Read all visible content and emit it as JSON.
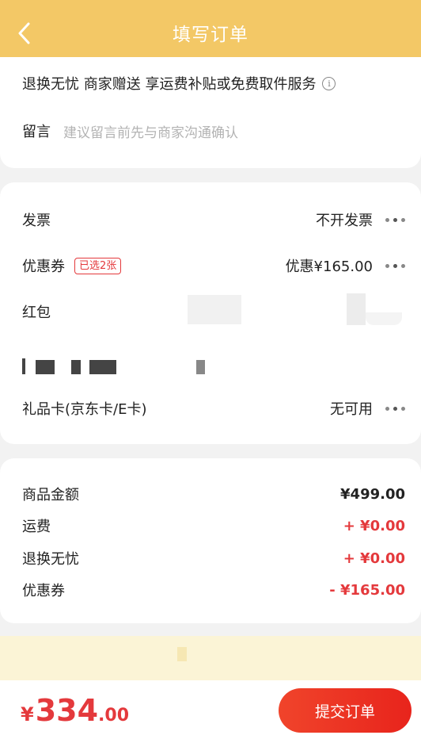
{
  "header": {
    "title": "填写订单"
  },
  "service": {
    "text": "退换无忧 商家赠送 享运费补贴或免费取件服务"
  },
  "note": {
    "label": "留言",
    "placeholder": "建议留言前先与商家沟通确认"
  },
  "options": {
    "invoice": {
      "label": "发票",
      "value": "不开发票"
    },
    "coupon": {
      "label": "优惠券",
      "badge": "已选2张",
      "value": "优惠¥165.00"
    },
    "redpacket": {
      "label": "红包"
    },
    "giftcard": {
      "label": "礼品卡(京东卡/E卡)",
      "value": "无可用"
    }
  },
  "summary": {
    "goods": {
      "label": "商品金额",
      "value": "¥499.00"
    },
    "shipping": {
      "label": "运费",
      "value": "+ ¥0.00"
    },
    "return": {
      "label": "退换无忧",
      "value": "+ ¥0.00"
    },
    "coupon": {
      "label": "优惠券",
      "value": "- ¥165.00"
    }
  },
  "footer": {
    "currency": "¥",
    "total_int": "334",
    "total_dec": ".00",
    "submit": "提交订单"
  },
  "colors": {
    "header": "#f3c866",
    "accent": "#e4393c"
  },
  "icons": [
    "back-arrow-icon",
    "info-icon",
    "more-dots-icon"
  ]
}
